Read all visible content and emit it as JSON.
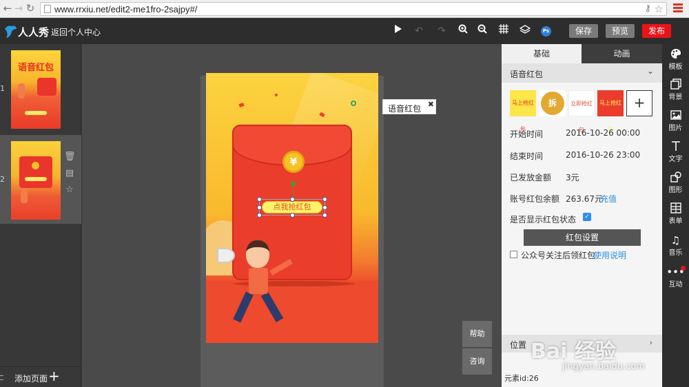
{
  "browser": {
    "url": "www.rrxiu.net/edit2-me1fro-2sajpy#/"
  },
  "header": {
    "logo_text": "人人秀",
    "back_link": "返回个人中心",
    "save_label": "保存",
    "preview_label": "预览",
    "publish_label": "发布",
    "ps_label": "Ps"
  },
  "pages": {
    "items": [
      {
        "number": "1",
        "title": "语音红包"
      },
      {
        "number": "2",
        "title": ""
      }
    ],
    "add_label": "添加页面"
  },
  "canvas": {
    "cta_label": "点我抢红包",
    "coin_glyph": "¥",
    "element_label": "语音红包",
    "help_label": "帮助",
    "consult_label": "咨询"
  },
  "panel": {
    "tabs": [
      "基础",
      "动画"
    ],
    "section_title": "语音红包",
    "style_options": [
      "马上抢红包",
      "拆",
      "立即抢红包",
      "马上抢红包",
      "+"
    ],
    "start_time_label": "开始时间",
    "start_time": "2016-10-26 00:00",
    "end_time_label": "结束时间",
    "end_time": "2016-10-26 23:00",
    "issued_label": "已发放金额",
    "issued_value": "3元",
    "balance_label": "账号红包余额",
    "balance_value": "263.67元",
    "recharge_label": "充值",
    "show_status_label": "是否显示红包状态",
    "show_status_checked": true,
    "settings_button": "红包设置",
    "follow_label": "公众号关注后领红包",
    "instructions_link": "使用说明",
    "position_label": "位置",
    "element_id": "元素id:26"
  },
  "rail": [
    {
      "label": "模板",
      "icon": "palette-icon"
    },
    {
      "label": "背景",
      "icon": "background-icon"
    },
    {
      "label": "图片",
      "icon": "image-icon"
    },
    {
      "label": "文字",
      "icon": "text-icon"
    },
    {
      "label": "图形",
      "icon": "shape-icon"
    },
    {
      "label": "表单",
      "icon": "form-icon"
    },
    {
      "label": "音乐",
      "icon": "music-icon"
    },
    {
      "label": "互动",
      "icon": "interaction-icon"
    }
  ],
  "watermark": {
    "main": "Bai 经验",
    "sub": "jingyan.baidu.com"
  },
  "colors": {
    "publish": "#e8141a",
    "header_bg": "#2d2d2d",
    "link": "#2a8fe0",
    "envelope": "#ea3d2c"
  }
}
